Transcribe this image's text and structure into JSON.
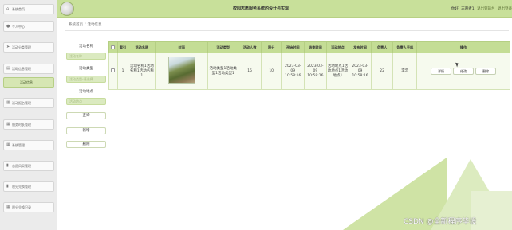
{
  "header": {
    "title": "校园志愿服务系统的设计与实现",
    "user_prefix": "你好,",
    "user_name": "志愿者1",
    "link_home": "退出到前台",
    "link_logout": "退出登录"
  },
  "sidebar": {
    "items": [
      {
        "label": "系统首页",
        "icon": "home-icon",
        "glyph": "⌂"
      },
      {
        "label": "个人中心",
        "icon": "user-icon",
        "glyph": "●"
      },
      {
        "label": "活动分类管理",
        "icon": "send-icon",
        "glyph": "➤"
      },
      {
        "label": "活动信息管理",
        "icon": "archive-icon",
        "glyph": "▤"
      },
      {
        "label": "活动信息",
        "icon": "",
        "glyph": ""
      },
      {
        "label": "活动报名管理",
        "icon": "grid-icon",
        "glyph": "▦"
      },
      {
        "label": "服务时长管理",
        "icon": "grid-icon",
        "glyph": "▦"
      },
      {
        "label": "系统管理",
        "icon": "grid-icon",
        "glyph": "▦"
      },
      {
        "label": "志愿风采管理",
        "icon": "chart-icon",
        "glyph": "▮"
      },
      {
        "label": "积分兑换管理",
        "icon": "bar-chart-icon",
        "glyph": "▮"
      },
      {
        "label": "积分兑换记录",
        "icon": "grid-icon",
        "glyph": "▦"
      }
    ],
    "active_index": 4
  },
  "breadcrumb": {
    "home": "系统首页",
    "separator": "/",
    "current": "活动信息"
  },
  "search": {
    "label_name": "活动名称",
    "placeholder_name": "活动名称",
    "label_type": "活动类型",
    "placeholder_type": "活动类型-请选择",
    "label_place": "活动地点",
    "placeholder_place": "活动地点",
    "query_button": "查询",
    "add_button": "新增",
    "delete_button": "删除"
  },
  "table": {
    "columns": [
      "索引",
      "活动名称",
      "封面",
      "活动类型",
      "活动人数",
      "积分",
      "开始时间",
      "结束时间",
      "活动地点",
      "发布时间",
      "负责人",
      "负责人手机",
      "操作"
    ],
    "rows": [
      {
        "index": "1",
        "name": "活动名称1活动名称1活动名称1",
        "cover_alt": "landscape-photo",
        "type": "活动类型1活动类型1活动类型1",
        "people": "15",
        "points": "10",
        "start": "2023-03-09 10:58:16",
        "end": "2023-03-09 10:58:16",
        "place": "活动地点1活动地点1活动地点1",
        "publish": "2023-03-09 10:58:16",
        "leader": "22",
        "phone": "李忠",
        "actions": [
          "详情",
          "修改",
          "删除"
        ]
      }
    ]
  },
  "watermark": "CSDN @全新程序毕设",
  "colors": {
    "accent": "#c8e09a",
    "accent_dark": "#b5cf83",
    "active_item": "#d6e6b3"
  }
}
